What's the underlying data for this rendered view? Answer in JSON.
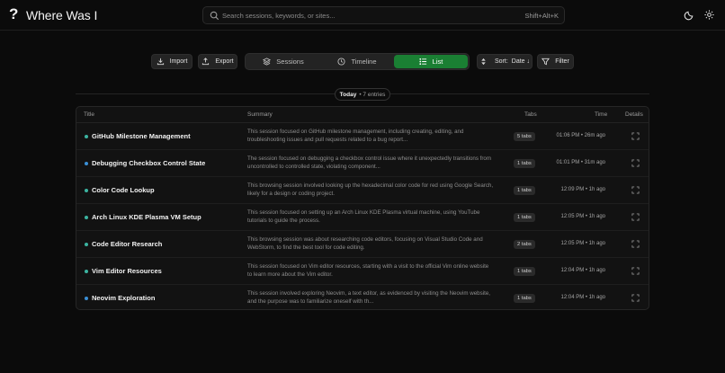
{
  "app": {
    "title": "Where Was I"
  },
  "search": {
    "placeholder": "Search sessions, keywords, or sites...",
    "shortcut": "Shift+Alt+K"
  },
  "toolbar": {
    "import_label": "Import",
    "export_label": "Export",
    "views": [
      {
        "label": "Sessions",
        "icon": "layers-icon"
      },
      {
        "label": "Timeline",
        "icon": "clock-icon"
      },
      {
        "label": "List",
        "icon": "list-icon",
        "active": true
      }
    ],
    "sort_label": "Sort:",
    "sort_value": "Date ↓",
    "filter_label": "Filter"
  },
  "group": {
    "day": "Today",
    "count": "• 7 entries"
  },
  "table": {
    "headers": {
      "title": "Title",
      "summary": "Summary",
      "tabs": "Tabs",
      "time": "Time",
      "details": "Details"
    },
    "rows": [
      {
        "title": "GitHub Milestone Management",
        "dot": "#3bb3a0",
        "summary": "This session focused on GitHub milestone management, including creating, editing, and troubleshooting issues and pull requests related to a bug report...",
        "tabs": "5 tabs",
        "time": "01:06 PM • 26m ago"
      },
      {
        "title": "Debugging Checkbox Control State",
        "dot": "#3a8fd6",
        "summary": "The session focused on debugging a checkbox control issue where it unexpectedly transitions from uncontrolled to controlled state, violating component...",
        "tabs": "1 tabs",
        "time": "01:01 PM • 31m ago"
      },
      {
        "title": "Color Code Lookup",
        "dot": "#3bb3a0",
        "summary": "This browsing session involved looking up the hexadecimal color code for red using Google Search, likely for a design or coding project.",
        "tabs": "1 tabs",
        "time": "12:09 PM • 1h ago"
      },
      {
        "title": "Arch Linux KDE Plasma VM Setup",
        "dot": "#3bb3a0",
        "summary": "This session focused on setting up an Arch Linux KDE Plasma virtual machine, using YouTube tutorials to guide the process.",
        "tabs": "1 tabs",
        "time": "12:05 PM • 1h ago"
      },
      {
        "title": "Code Editor Research",
        "dot": "#3bb3a0",
        "summary": "This browsing session was about researching code editors, focusing on Visual Studio Code and WebStorm, to find the best tool for code editing.",
        "tabs": "2 tabs",
        "time": "12:05 PM • 1h ago"
      },
      {
        "title": "Vim Editor Resources",
        "dot": "#3bb3a0",
        "summary": "This session focused on Vim editor resources, starting with a visit to the official Vim online website to learn more about the Vim editor.",
        "tabs": "1 tabs",
        "time": "12:04 PM • 1h ago"
      },
      {
        "title": "Neovim Exploration",
        "dot": "#3a8fd6",
        "summary": "This session involved exploring Neovim, a text editor, as evidenced by visiting the Neovim website, and the purpose was to familiarize oneself with th...",
        "tabs": "1 tabs",
        "time": "12:04 PM • 1h ago"
      }
    ]
  },
  "colors": {
    "accent": "#1a7f33",
    "background": "#0b0b0b"
  }
}
